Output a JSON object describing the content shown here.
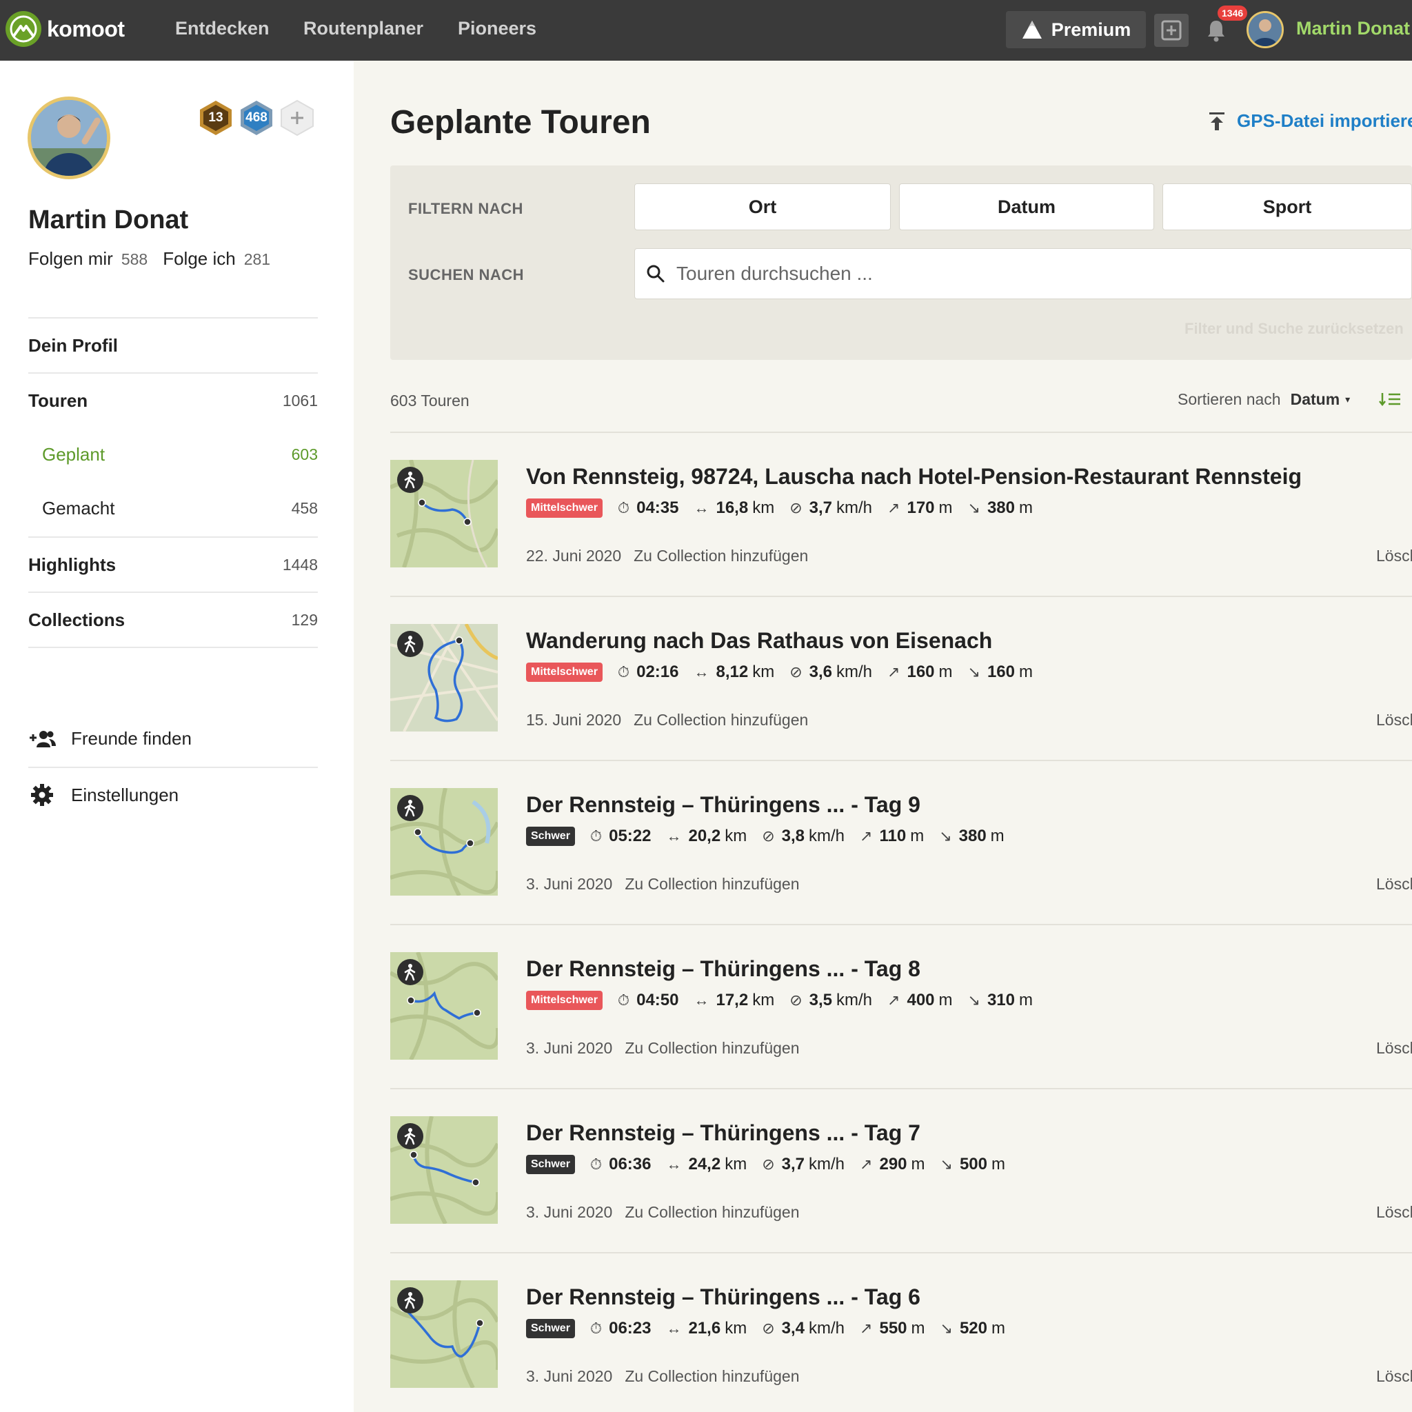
{
  "app": {
    "brand": "komoot",
    "nav": [
      "Entdecken",
      "Routenplaner",
      "Pioneers"
    ],
    "premium_label": "Premium",
    "notifications_count": "1346",
    "username": "Martin Donat",
    "accent_color": "#6aa127"
  },
  "profile": {
    "name": "Martin Donat",
    "badges": [
      "13",
      "468"
    ],
    "followers_label": "Folgen mir",
    "followers_count": "588",
    "following_label": "Folge ich",
    "following_count": "281"
  },
  "sidebar": {
    "items": [
      {
        "label": "Dein Profil",
        "count": ""
      },
      {
        "label": "Touren",
        "count": "1061"
      },
      {
        "label": "Geplant",
        "count": "603"
      },
      {
        "label": "Gemacht",
        "count": "458"
      },
      {
        "label": "Highlights",
        "count": "1448"
      },
      {
        "label": "Collections",
        "count": "129"
      }
    ],
    "find_friends": "Freunde finden",
    "settings": "Einstellungen"
  },
  "main": {
    "title": "Geplante Touren",
    "import_label": "GPS-Datei importieren",
    "filter_label": "FILTERN NACH",
    "filters": [
      "Ort",
      "Datum",
      "Sport"
    ],
    "search_label": "SUCHEN NACH",
    "search_placeholder": "Touren durchsuchen ...",
    "reset_label": "Filter und Suche zurücksetzen",
    "tour_count": "603 Touren",
    "sort_label": "Sortieren nach",
    "sort_value": "Datum",
    "add_collection": "Zu Collection hinzufügen",
    "delete_label": "Löschen"
  },
  "tours": [
    {
      "title": "Von Rennsteig, 98724, Lauscha nach Hotel-Pension-Restaurant Rennsteig",
      "difficulty": "Mittelschwer",
      "duration": "04:35",
      "distance": "16,8",
      "speed": "3,7",
      "up": "170",
      "down": "380",
      "date": "22. Juni 2020"
    },
    {
      "title": "Wanderung nach Das Rathaus von Eisenach",
      "difficulty": "Mittelschwer",
      "duration": "02:16",
      "distance": "8,12",
      "speed": "3,6",
      "up": "160",
      "down": "160",
      "date": "15. Juni 2020"
    },
    {
      "title": "Der Rennsteig – Thüringens ... - Tag 9",
      "difficulty": "Schwer",
      "duration": "05:22",
      "distance": "20,2",
      "speed": "3,8",
      "up": "110",
      "down": "380",
      "date": "3. Juni 2020"
    },
    {
      "title": "Der Rennsteig – Thüringens ... - Tag 8",
      "difficulty": "Mittelschwer",
      "duration": "04:50",
      "distance": "17,2",
      "speed": "3,5",
      "up": "400",
      "down": "310",
      "date": "3. Juni 2020"
    },
    {
      "title": "Der Rennsteig – Thüringens ... - Tag 7",
      "difficulty": "Schwer",
      "duration": "06:36",
      "distance": "24,2",
      "speed": "3,7",
      "up": "290",
      "down": "500",
      "date": "3. Juni 2020"
    },
    {
      "title": "Der Rennsteig – Thüringens ... - Tag 6",
      "difficulty": "Schwer",
      "duration": "06:23",
      "distance": "21,6",
      "speed": "3,4",
      "up": "550",
      "down": "520",
      "date": "3. Juni 2020"
    }
  ],
  "units": {
    "distance": "km",
    "speed": "km/h",
    "elevation": "m"
  }
}
